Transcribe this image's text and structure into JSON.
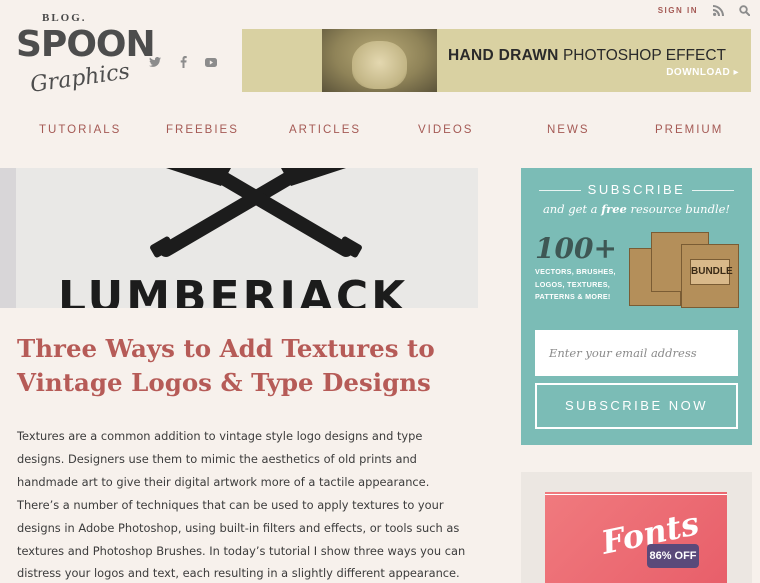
{
  "header": {
    "logo": {
      "badge": "BLOG.",
      "word1": "SPOON",
      "word2": "Graphics"
    },
    "social_icons": [
      "twitter-icon",
      "facebook-icon",
      "youtube-icon"
    ],
    "signin_label": "SIGN IN",
    "banner": {
      "bold": "HAND DRAWN",
      "rest": " PHOTOSHOP EFFECT",
      "download": "DOWNLOAD ▸"
    },
    "nav": [
      "TUTORIALS",
      "FREEBIES",
      "ARTICLES",
      "VIDEOS",
      "NEWS",
      "PREMIUM"
    ]
  },
  "hero": {
    "word": "LUMBERJACK"
  },
  "article": {
    "title": "Three Ways to Add Textures to Vintage Logos & Type Designs",
    "body": "Textures are a common addition to vintage style logo designs and type designs. Designers use them to mimic the aesthetics of old prints and handmade art to give their digital artwork more of a tactile appearance. There’s a number of techniques that can be used to apply textures to your designs in Adobe Photoshop, using built-in filters and effects, or tools such as textures and Photoshop Brushes. In today’s tutorial I show three ways you can distress your logos and text, each resulting in a slightly different appearance."
  },
  "sidebar": {
    "subscribe": {
      "heading": "SUBSCRIBE",
      "sub_pre": "and get a ",
      "sub_em": "free",
      "sub_post": " resource bundle!",
      "count": "100+",
      "list": "VECTORS, BRUSHES, LOGOS, TEXTURES, PATTERNS & MORE!",
      "box_label": "BUNDLE",
      "email_placeholder": "Enter your email address",
      "button": "SUBSCRIBE NOW"
    },
    "ad2": {
      "word": "Fonts",
      "discount": "86% OFF"
    }
  }
}
